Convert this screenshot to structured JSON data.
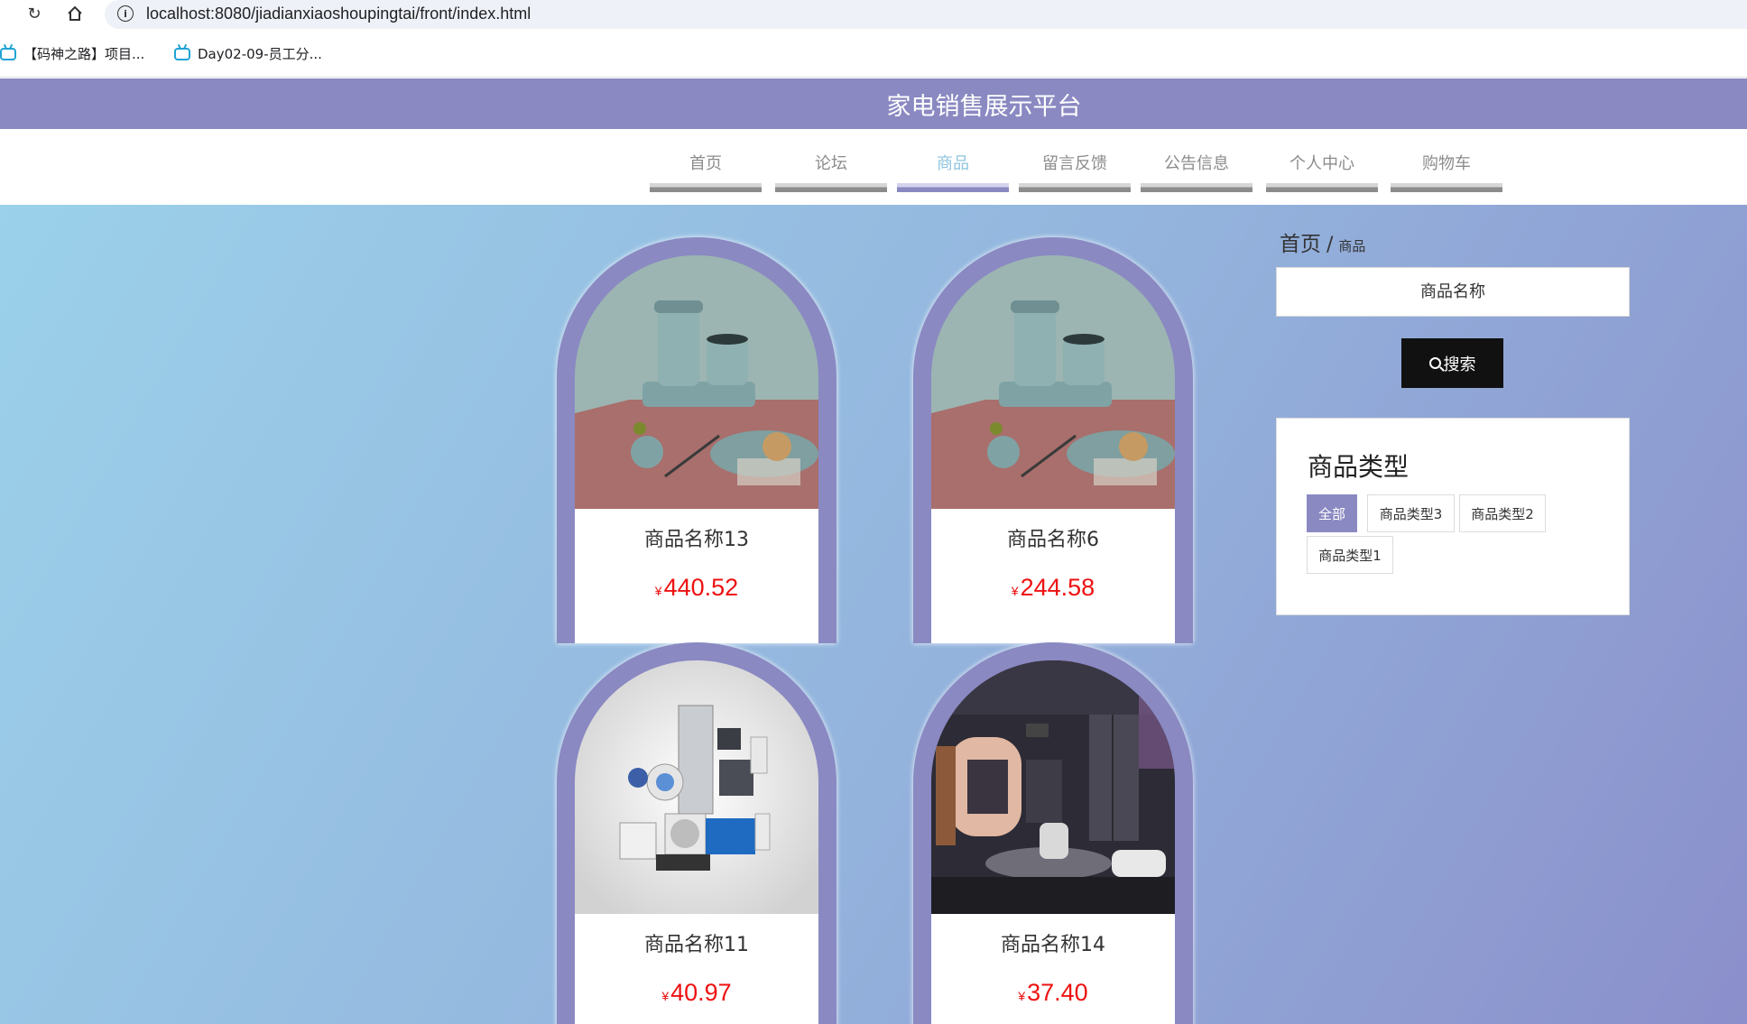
{
  "browser": {
    "url": "localhost:8080/jiadianxiaoshoupingtai/front/index.html",
    "bookmarks": [
      "【码神之路】项目...",
      "Day02-09-员工分..."
    ]
  },
  "site": {
    "title": "家电销售展示平台",
    "nav": [
      "首页",
      "论坛",
      "商品",
      "留言反馈",
      "公告信息",
      "个人中心",
      "购物车"
    ],
    "active_nav_index": 2
  },
  "products": [
    {
      "name": "商品名称13",
      "currency": "¥",
      "price": "440.52",
      "image": "kettle-set-photo"
    },
    {
      "name": "商品名称6",
      "currency": "¥",
      "price": "244.58",
      "image": "kettle-set-photo"
    },
    {
      "name": "商品名称11",
      "currency": "¥",
      "price": "40.97",
      "image": "appliances-collage-photo"
    },
    {
      "name": "商品名称14",
      "currency": "¥",
      "price": "37.40",
      "image": "kitchen-showroom-photo"
    }
  ],
  "sidebar": {
    "breadcrumb": {
      "home": "首页",
      "separator": "/",
      "current": "商品"
    },
    "search": {
      "placeholder": "商品名称",
      "button_label": "搜索"
    },
    "categories": {
      "title": "商品类型",
      "items": [
        "全部",
        "商品类型3",
        "商品类型2",
        "商品类型1"
      ],
      "active_index": 0
    }
  },
  "colors": {
    "accent": "#8a89c2",
    "price": "#ee1111",
    "active_nav_text": "#8fc4de"
  }
}
